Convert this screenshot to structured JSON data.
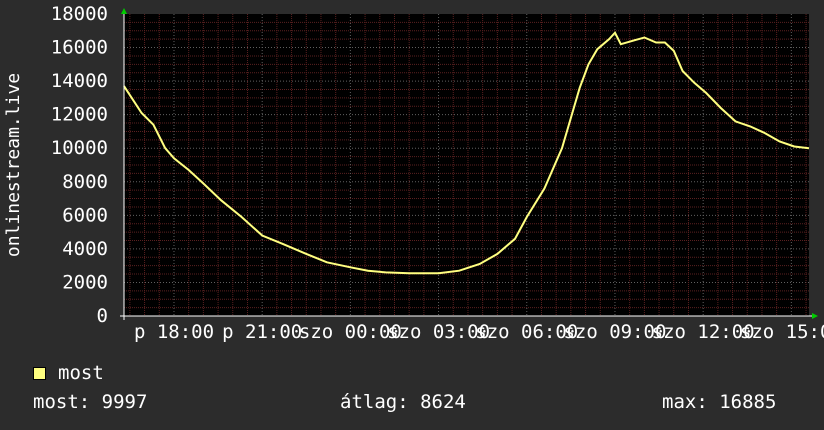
{
  "chart_data": {
    "type": "line",
    "ylabel": "onlinestream.live",
    "ylim": [
      0,
      18000
    ],
    "yticks": [
      0,
      2000,
      4000,
      6000,
      8000,
      10000,
      12000,
      14000,
      16000,
      18000
    ],
    "x_range_hours": [
      16.3,
      15.6
    ],
    "xtick_labels": [
      {
        "label": "p 18:00",
        "hour": 18
      },
      {
        "label": "p 21:00",
        "hour": 21
      },
      {
        "label": "szo 00:00",
        "hour": 0
      },
      {
        "label": "szo 03:00",
        "hour": 3
      },
      {
        "label": "szo 06:00",
        "hour": 6
      },
      {
        "label": "szo 09:00",
        "hour": 9
      },
      {
        "label": "szo 12:00",
        "hour": 12
      },
      {
        "label": "szo 15:00",
        "hour": 15
      }
    ],
    "grid": true,
    "series": [
      {
        "name": "most",
        "color": "#ffff80",
        "x_hours": [
          16.3,
          16.6,
          16.9,
          17.3,
          17.7,
          18.0,
          18.5,
          19.0,
          19.6,
          20.3,
          21.0,
          21.7,
          22.5,
          23.2,
          0.0,
          0.6,
          1.2,
          2.0,
          3.0,
          3.7,
          4.4,
          5.0,
          5.6,
          6.0,
          6.6,
          7.2,
          7.8,
          8.1,
          8.4,
          8.8,
          9.0,
          9.2,
          9.6,
          10.0,
          10.4,
          10.7,
          11.0,
          11.3,
          11.7,
          12.1,
          12.6,
          13.1,
          13.6,
          14.1,
          14.6,
          15.1,
          15.6
        ],
        "values": [
          13700,
          12900,
          12100,
          11400,
          10000,
          9400,
          8700,
          7900,
          6900,
          5900,
          4800,
          4300,
          3700,
          3200,
          2900,
          2700,
          2600,
          2550,
          2550,
          2700,
          3100,
          3700,
          4600,
          5900,
          7600,
          10000,
          13600,
          15000,
          15900,
          16500,
          16885,
          16200,
          16400,
          16600,
          16300,
          16300,
          15800,
          14600,
          13900,
          13300,
          12400,
          11600,
          11300,
          10900,
          10400,
          10100,
          9997
        ]
      }
    ]
  },
  "legend": {
    "label": "most",
    "color": "#ffff80"
  },
  "stats": {
    "last": "most: 9997",
    "avg": "átlag: 8624",
    "max": "max: 16885"
  },
  "colors": {
    "background": "#2c2c2c",
    "plot_background": "#000000",
    "grid_minor": "#5a2020",
    "grid_major": "#606060",
    "axis": "#ffffff",
    "arrow": "#00cc00"
  }
}
